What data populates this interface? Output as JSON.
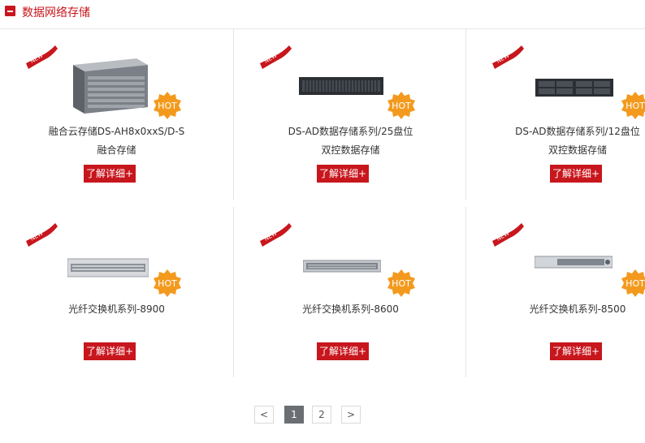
{
  "header": {
    "title": "数据网络存储"
  },
  "products": [
    {
      "name": "融合云存储DS-AH8x0xxS/D-S",
      "subtitle": "融合存储",
      "button": "了解详细+",
      "badge_new": "NEW",
      "badge_hot": "HOT",
      "image": "storage-server-icon"
    },
    {
      "name": "DS-AD数据存储系列/25盘位",
      "subtitle": "双控数据存储",
      "button": "了解详细+",
      "badge_new": "NEW",
      "badge_hot": "HOT",
      "image": "rack-storage-icon"
    },
    {
      "name": "DS-AD数据存储系列/12盘位",
      "subtitle": "双控数据存储",
      "button": "了解详细+",
      "badge_new": "NEW",
      "badge_hot": "HOT",
      "image": "rack-storage-icon"
    },
    {
      "name": "光纤交换机系列-8900",
      "subtitle": "",
      "button": "了解详细+",
      "badge_new": "NEW",
      "badge_hot": "HOT",
      "image": "switch-icon"
    },
    {
      "name": "光纤交换机系列-8600",
      "subtitle": "",
      "button": "了解详细+",
      "badge_new": "NEW",
      "badge_hot": "HOT",
      "image": "switch-icon"
    },
    {
      "name": "光纤交换机系列-8500",
      "subtitle": "",
      "button": "了解详细+",
      "badge_new": "NEW",
      "badge_hot": "HOT",
      "image": "switch-icon"
    }
  ],
  "pagination": {
    "prev": "<",
    "pages": [
      "1",
      "2"
    ],
    "current": "1",
    "next": ">"
  },
  "colors": {
    "accent": "#c8161d",
    "hot": "#f39a1e",
    "pager_active": "#6b6e73"
  }
}
